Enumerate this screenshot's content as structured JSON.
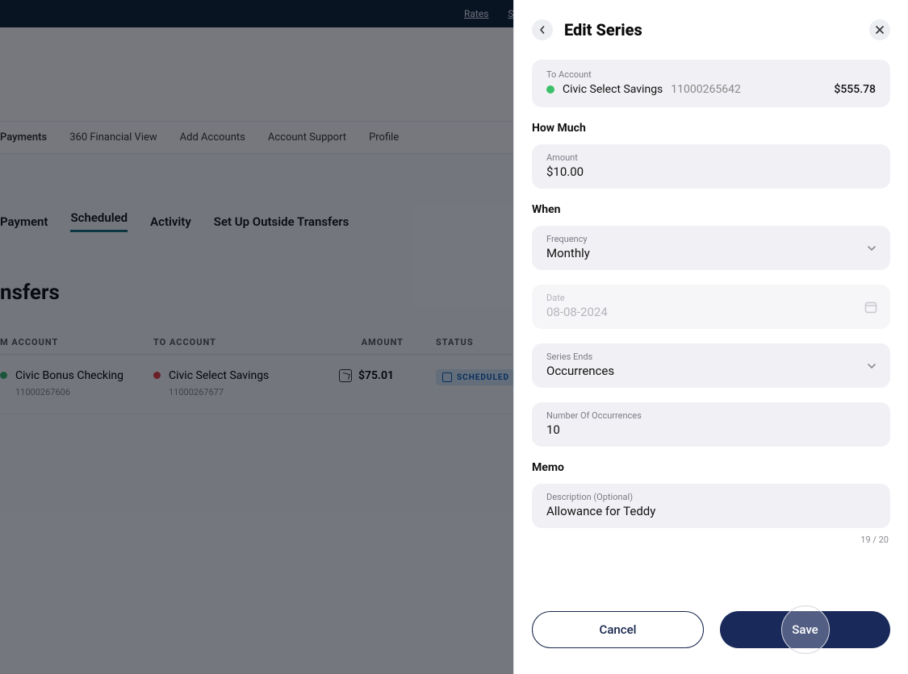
{
  "background": {
    "top_nav": {
      "rates": "Rates",
      "status": "Stat"
    },
    "menu": {
      "payments": "Payments",
      "financial_view": "360 Financial View",
      "add_accounts": "Add Accounts",
      "account_support": "Account Support",
      "profile": "Profile"
    },
    "tabs": {
      "payment": "Payment",
      "scheduled": "Scheduled",
      "activity": "Activity",
      "outside": "Set Up Outside Transfers"
    },
    "heading": "nsfers",
    "cols": {
      "from": "M ACCOUNT",
      "to": "TO ACCOUNT",
      "amount": "AMOUNT",
      "status": "STATUS"
    },
    "row": {
      "from_name": "Civic Bonus Checking",
      "from_num": "11000267606",
      "to_name": "Civic Select Savings",
      "to_num": "11000267677",
      "amount": "$75.01",
      "status": "SCHEDULED"
    }
  },
  "panel": {
    "title": "Edit Series",
    "to_account": {
      "label": "To Account",
      "name": "Civic Select Savings",
      "number": "11000265642",
      "balance": "$555.78"
    },
    "how_much_label": "How Much",
    "amount": {
      "label": "Amount",
      "value": "$10.00"
    },
    "when_label": "When",
    "frequency": {
      "label": "Frequency",
      "value": "Monthly"
    },
    "date": {
      "label": "Date",
      "value": "08-08-2024"
    },
    "series_ends": {
      "label": "Series Ends",
      "value": "Occurrences"
    },
    "num_occurrences": {
      "label": "Number Of Occurrences",
      "value": "10"
    },
    "memo_label": "Memo",
    "memo": {
      "label": "Description (Optional)",
      "value": "Allowance for Teddy",
      "counter": "19 / 20"
    },
    "cancel": "Cancel",
    "save": "Save"
  }
}
